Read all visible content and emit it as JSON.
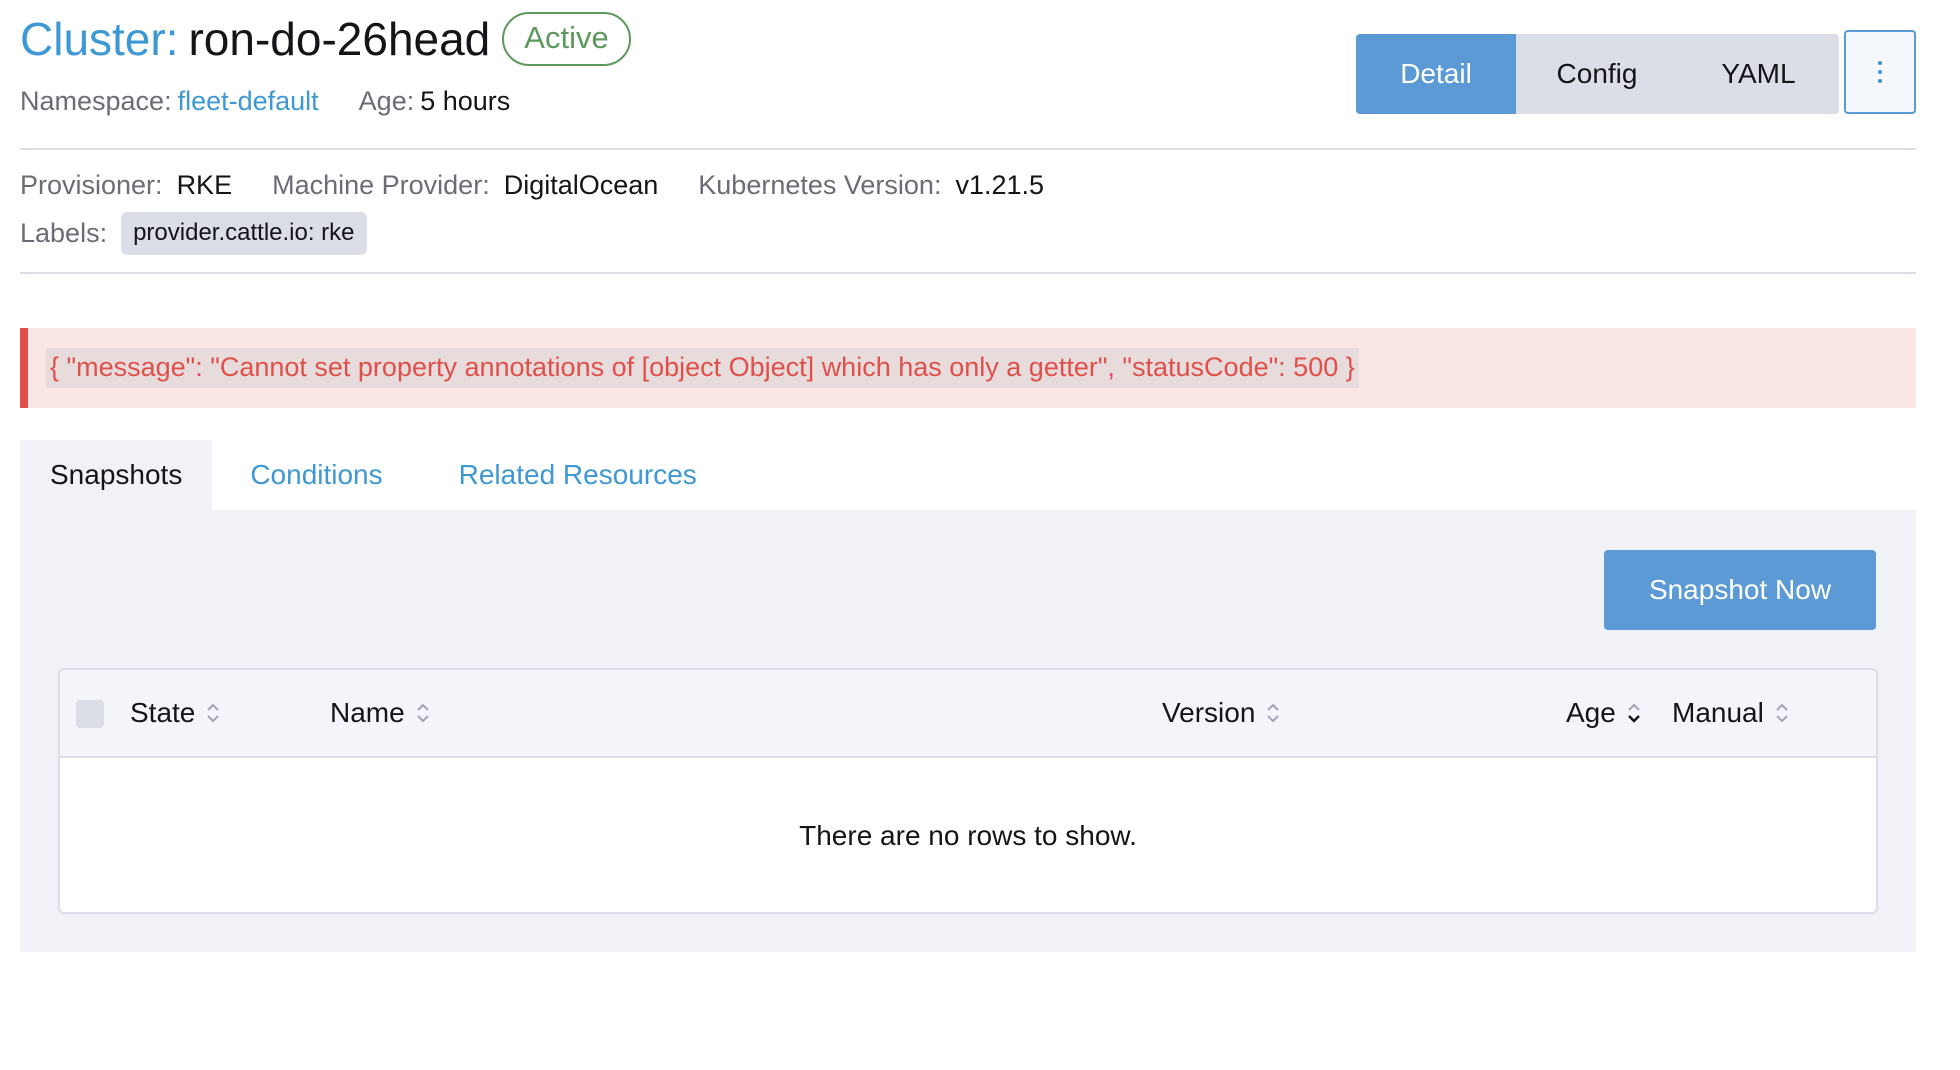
{
  "header": {
    "title_prefix": "Cluster:",
    "title_name": "ron-do-26head",
    "status": "Active",
    "namespace_label": "Namespace:",
    "namespace_value": "fleet-default",
    "age_label": "Age:",
    "age_value": "5 hours"
  },
  "view_switcher": {
    "options": [
      "Detail",
      "Config",
      "YAML"
    ],
    "selected": "Detail"
  },
  "details": {
    "provisioner_label": "Provisioner:",
    "provisioner_value": "RKE",
    "machine_provider_label": "Machine Provider:",
    "machine_provider_value": "DigitalOcean",
    "k8s_version_label": "Kubernetes Version:",
    "k8s_version_value": "v1.21.5",
    "labels_label": "Labels:",
    "labels": [
      "provider.cattle.io: rke"
    ]
  },
  "error": {
    "message": "{ \"message\": \"Cannot set property annotations of [object Object] which has only a getter\", \"statusCode\": 500 }"
  },
  "tabs": {
    "items": [
      "Snapshots",
      "Conditions",
      "Related Resources"
    ],
    "selected": "Snapshots"
  },
  "snapshots": {
    "action_label": "Snapshot Now",
    "columns": [
      "State",
      "Name",
      "Version",
      "Age",
      "Manual"
    ],
    "rows": [],
    "empty_message": "There are no rows to show."
  },
  "colors": {
    "accent": "#3d98d3",
    "primary_button": "#5b9ad5",
    "status_active": "#5d995d",
    "error": "#e0504a",
    "error_bg": "#fbe6e6"
  }
}
